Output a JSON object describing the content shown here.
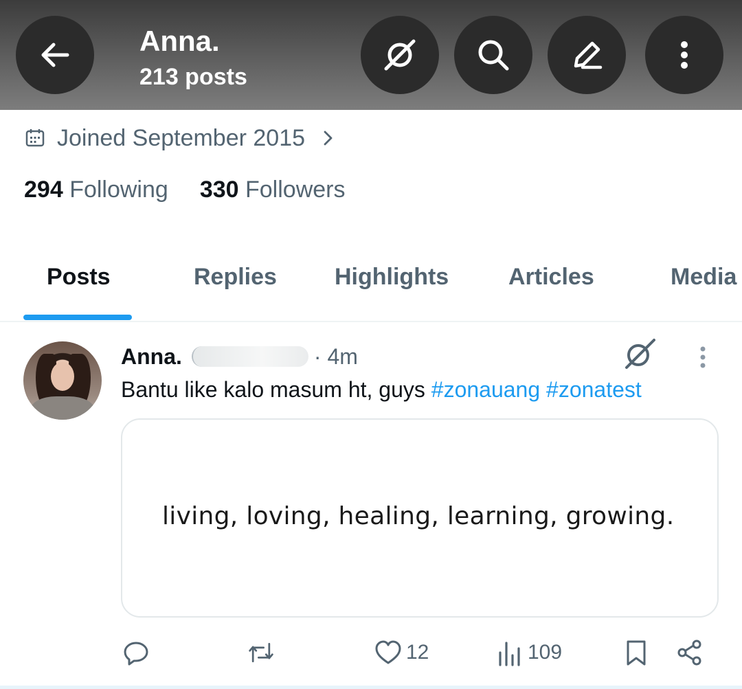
{
  "header": {
    "name": "Anna.",
    "posts_count": "213 posts"
  },
  "profile": {
    "joined": "Joined September 2015",
    "following_count": "294",
    "following_label": "Following",
    "followers_count": "330",
    "followers_label": "Followers"
  },
  "tabs": [
    {
      "label": "Posts",
      "active": true
    },
    {
      "label": "Replies",
      "active": false
    },
    {
      "label": "Highlights",
      "active": false
    },
    {
      "label": "Articles",
      "active": false
    },
    {
      "label": "Media",
      "active": false
    }
  ],
  "post": {
    "author": "Anna.",
    "time": "· 4m",
    "text": "Bantu like kalo masum ht, guys ",
    "hashtags": [
      "#zonauang",
      "#zonatest"
    ],
    "media_text": "living, loving, healing, learning, growing.",
    "likes": "12",
    "views": "109"
  },
  "colors": {
    "accent": "#1d9bf0",
    "secondary_text": "#536471",
    "primary_text": "#0f1419",
    "header_button": "#2b2b2b"
  },
  "icons": {
    "back": "arrow-left-icon",
    "grok": "grok-icon",
    "search": "search-icon",
    "compose": "pencil-icon",
    "more": "more-vertical-icon",
    "calendar": "calendar-icon",
    "reply": "reply-icon",
    "repost": "repost-icon",
    "like": "heart-icon",
    "views": "views-icon",
    "bookmark": "bookmark-icon",
    "share": "share-icon"
  }
}
